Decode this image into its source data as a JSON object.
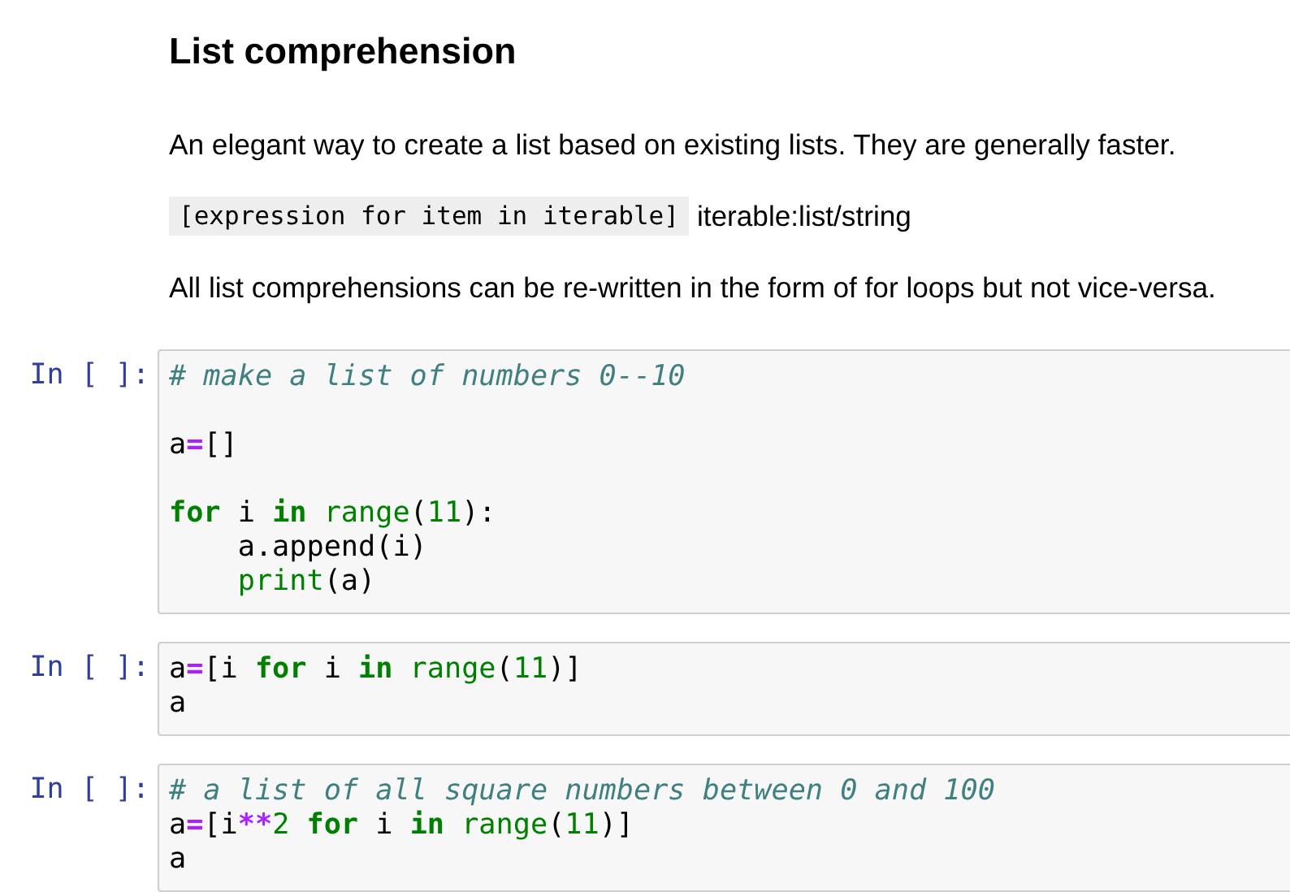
{
  "markdown": {
    "heading": "List comprehension",
    "paragraphs": [
      [
        {
          "kind": "text",
          "text": "An elegant way to create a list based on existing lists. They are generally faster."
        }
      ],
      [
        {
          "kind": "code",
          "text": "[expression for item in iterable]"
        },
        {
          "kind": "text",
          "text": "iterable:list/string"
        }
      ],
      [
        {
          "kind": "text",
          "text": "All list comprehensions can be re-written in the form of for loops but not vice-versa."
        }
      ]
    ]
  },
  "cells": [
    {
      "prompt": "In [ ]:",
      "lines": [
        {
          "blank_before": false,
          "tokens": [
            {
              "kind": "comment",
              "text": "# make a list of numbers 0--10"
            }
          ]
        },
        {
          "blank_before": true,
          "tokens": [
            {
              "kind": "name",
              "text": "a"
            },
            {
              "kind": "op",
              "text": "="
            },
            {
              "kind": "name",
              "text": "[]"
            }
          ]
        },
        {
          "blank_before": true,
          "tokens": [
            {
              "kind": "keyword",
              "text": "for"
            },
            {
              "kind": "name",
              "text": " i "
            },
            {
              "kind": "keyword",
              "text": "in"
            },
            {
              "kind": "builtin",
              "text": " range"
            },
            {
              "kind": "name",
              "text": "("
            },
            {
              "kind": "number",
              "text": "11"
            },
            {
              "kind": "name",
              "text": "):"
            }
          ]
        },
        {
          "blank_before": false,
          "tokens": [
            {
              "kind": "name",
              "text": "    a.append(i)"
            }
          ]
        },
        {
          "blank_before": false,
          "tokens": [
            {
              "kind": "builtin",
              "text": "    print"
            },
            {
              "kind": "name",
              "text": "(a)"
            }
          ]
        }
      ]
    },
    {
      "prompt": "In [ ]:",
      "lines": [
        {
          "blank_before": false,
          "tokens": [
            {
              "kind": "name",
              "text": "a"
            },
            {
              "kind": "op",
              "text": "="
            },
            {
              "kind": "name",
              "text": "[i "
            },
            {
              "kind": "keyword",
              "text": "for"
            },
            {
              "kind": "name",
              "text": " i "
            },
            {
              "kind": "keyword",
              "text": "in"
            },
            {
              "kind": "builtin",
              "text": " range"
            },
            {
              "kind": "name",
              "text": "("
            },
            {
              "kind": "number",
              "text": "11"
            },
            {
              "kind": "name",
              "text": ")]"
            }
          ]
        },
        {
          "blank_before": false,
          "tokens": [
            {
              "kind": "name",
              "text": "a"
            }
          ]
        }
      ]
    },
    {
      "prompt": "In [ ]:",
      "lines": [
        {
          "blank_before": false,
          "tokens": [
            {
              "kind": "comment",
              "text": "# a list of all square numbers between 0 and 100"
            }
          ]
        },
        {
          "blank_before": false,
          "tokens": [
            {
              "kind": "name",
              "text": "a"
            },
            {
              "kind": "op",
              "text": "="
            },
            {
              "kind": "name",
              "text": "[i"
            },
            {
              "kind": "op",
              "text": "**"
            },
            {
              "kind": "number",
              "text": "2"
            },
            {
              "kind": "keyword",
              "text": " for"
            },
            {
              "kind": "name",
              "text": " i "
            },
            {
              "kind": "keyword",
              "text": "in"
            },
            {
              "kind": "builtin",
              "text": " range"
            },
            {
              "kind": "name",
              "text": "("
            },
            {
              "kind": "number",
              "text": "11"
            },
            {
              "kind": "name",
              "text": ")]"
            }
          ]
        },
        {
          "blank_before": false,
          "tokens": [
            {
              "kind": "name",
              "text": "a"
            }
          ]
        }
      ]
    }
  ]
}
